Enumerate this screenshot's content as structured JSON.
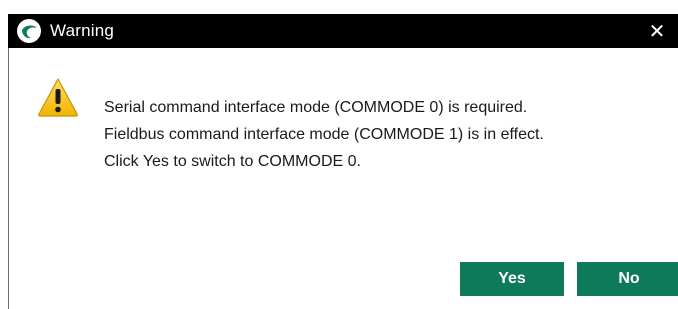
{
  "window": {
    "title": "Warning",
    "close_glyph": "✕",
    "app_icon": "app-logo-icon",
    "title_bar_color": "#000000"
  },
  "message": {
    "icon": "warning-icon",
    "lines": [
      "Serial command interface mode (COMMODE 0) is required.",
      "Fieldbus command interface mode (COMMODE 1) is in effect.",
      "Click Yes to switch to COMMODE 0."
    ]
  },
  "buttons": {
    "yes_label": "Yes",
    "no_label": "No",
    "color": "#0f7a5a"
  }
}
